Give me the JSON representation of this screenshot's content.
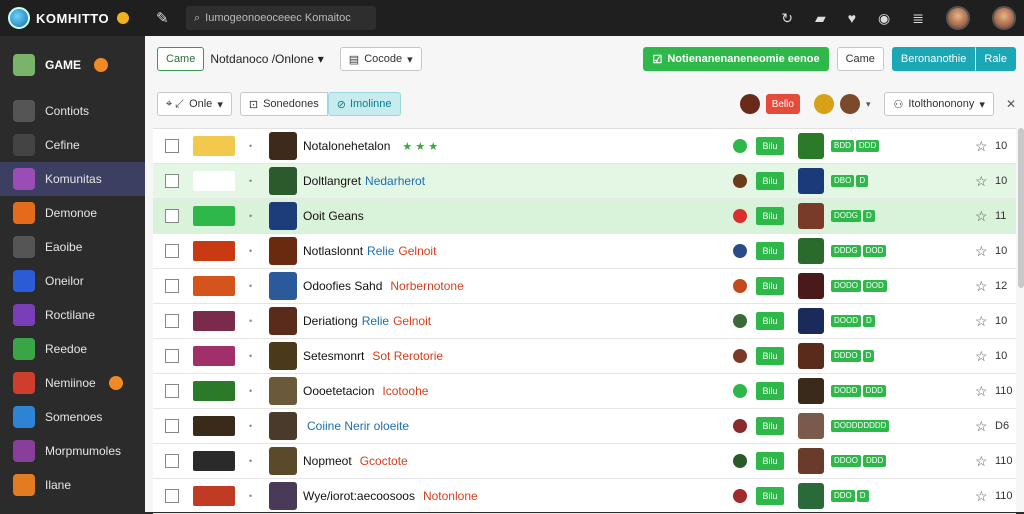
{
  "app": {
    "title": "KOMHITTO",
    "search_placeholder": "Iumogeonoeoceeec Komaitoc"
  },
  "sidebar": {
    "items": [
      {
        "label": "GAME",
        "icon": "game-icon",
        "color": "#7ab36a",
        "badge": true
      },
      {
        "label": "Contiots",
        "icon": "folder-icon",
        "color": "#555"
      },
      {
        "label": "Cefine",
        "icon": "pen-icon",
        "color": "#444"
      },
      {
        "label": "Komunitas",
        "icon": "community-icon",
        "color": "#9b4db7",
        "active": true
      },
      {
        "label": "Demonoe",
        "icon": "flame-icon",
        "color": "#e46a1c"
      },
      {
        "label": "Eaoibe",
        "icon": "g-icon",
        "color": "#555"
      },
      {
        "label": "Oneilor",
        "icon": "cube-icon",
        "color": "#2c5bd8"
      },
      {
        "label": "Roctilane",
        "icon": "purple-icon",
        "color": "#7a3fb8"
      },
      {
        "label": "Reedoe",
        "icon": "green-icon",
        "color": "#3aa547"
      },
      {
        "label": "Nemiinoe",
        "icon": "fire-icon",
        "color": "#cf3e2c",
        "badge": true
      },
      {
        "label": "Somenoes",
        "icon": "blue-icon",
        "color": "#2d83d4"
      },
      {
        "label": "Morpmumoles",
        "icon": "warrior-icon",
        "color": "#8a3e9c"
      },
      {
        "label": "Ilane",
        "icon": "orange-icon",
        "color": "#e27b22"
      }
    ]
  },
  "toolbar1": {
    "btn1": "Came",
    "dd1": "Notdanoco /Onlone",
    "btn2": "Cocode",
    "green_btn": "Notienanenaneneomie eenoe",
    "plain_btn": "Came",
    "teal_btn": "Beronanothie",
    "teal_btn2": "Rale"
  },
  "toolbar2": {
    "filter": "Onle",
    "sort": "Sonedones",
    "tag": "Imolinne",
    "chip": "Bello",
    "right_dd": "Itolthononony"
  },
  "rows": [
    {
      "thumb": "#f2c94c",
      "art": "#3d2a1a",
      "title": "Notalonehetalon",
      "sub": "",
      "red": "",
      "stars": "★ ★ ★",
      "mini": "#2fb84a",
      "sq": "Bilu",
      "art2": "#2a7a2a",
      "pills": [
        "BDD",
        "DDD"
      ],
      "num": "10",
      "hl": ""
    },
    {
      "thumb": "#ffffff",
      "art": "#2c5a2c",
      "title": "Doltlangret",
      "sub": "Nedarherot",
      "red": "",
      "stars": "",
      "mini": "#6b3a1a",
      "sq": "Bilu",
      "art2": "#1a3a7a",
      "pills": [
        "DBO",
        "D"
      ],
      "num": "10",
      "hl": "hl"
    },
    {
      "thumb": "#2fb84a",
      "art": "#1c3d7a",
      "title": "Ooit Geans",
      "sub": "",
      "red": "",
      "stars": "",
      "mini": "#d9302b",
      "sq": "Bilu",
      "art2": "#7a3a2a",
      "pills": [
        "DODG",
        "D"
      ],
      "num": "11",
      "hl": "hl2"
    },
    {
      "thumb": "#c93a12",
      "art": "#6a2a10",
      "title": "Notlaslonnt",
      "sub": "Relie",
      "red": "Gelnoit",
      "stars": "",
      "mini": "#2a4a8a",
      "sq": "Bilu",
      "art2": "#2a6a2a",
      "pills": [
        "DDDG",
        "DOD"
      ],
      "num": "10",
      "hl": ""
    },
    {
      "thumb": "#d4541b",
      "art": "#2a5a9a",
      "title": "Odoofies Sahd",
      "sub": "",
      "red": "Norbernotone",
      "stars": "",
      "mini": "#c24a1c",
      "sq": "Bilu",
      "art2": "#4a1a1a",
      "pills": [
        "DODO",
        "DOD"
      ],
      "num": "12",
      "hl": ""
    },
    {
      "thumb": "#7a2a4a",
      "art": "#5a2a1a",
      "title": "Deriationg",
      "sub": "Relie",
      "red": "Gelnoit",
      "stars": "",
      "mini": "#3a6a3a",
      "sq": "Bilu",
      "art2": "#1a2a5a",
      "pills": [
        "DOOD",
        "D"
      ],
      "num": "10",
      "hl": ""
    },
    {
      "thumb": "#a1306a",
      "art": "#4a3a1a",
      "title": "Setesmonrt",
      "sub": "",
      "red": "Sot Rerotorie",
      "stars": "",
      "mini": "#7a3a2a",
      "sq": "Bilu",
      "art2": "#5a2a1a",
      "pills": [
        "DDDO",
        "D"
      ],
      "num": "10",
      "hl": ""
    },
    {
      "thumb": "#2a7a2a",
      "art": "#6a5a3a",
      "title": "Oooetetacion",
      "sub": "",
      "red": "Icotoohe",
      "stars": "",
      "mini": "#2fb84a",
      "sq": "Bilu",
      "art2": "#3a2a1a",
      "pills": [
        "DODD",
        "DDD"
      ],
      "num": "110",
      "hl": ""
    },
    {
      "thumb": "#3a2a1a",
      "art": "#4a3a2a",
      "title": "",
      "sub": "Coiine Nerir oloeite",
      "red": "",
      "stars": "",
      "mini": "#8a2a2a",
      "sq": "Bilu",
      "art2": "#7a5a4a",
      "pills": [
        "DODDDDDDD"
      ],
      "num": "D6",
      "hl": ""
    },
    {
      "thumb": "#2a2a2a",
      "art": "#5a4a2a",
      "title": "Nopmeot",
      "sub": "",
      "red": "Gcoctote",
      "stars": "",
      "mini": "#2a5a2a",
      "sq": "Bilu",
      "art2": "#6a3a2a",
      "pills": [
        "DDOO",
        "DDD"
      ],
      "num": "110",
      "hl": ""
    },
    {
      "thumb": "#c13a24",
      "art": "#4a3a5a",
      "title": "Wye/iorot:aecoosoos",
      "sub": "",
      "red": "Notonlone",
      "stars": "",
      "mini": "#a12a2a",
      "sq": "Bilu",
      "art2": "#2a6a3a",
      "pills": [
        "DDO",
        "D"
      ],
      "num": "110",
      "hl": ""
    }
  ]
}
